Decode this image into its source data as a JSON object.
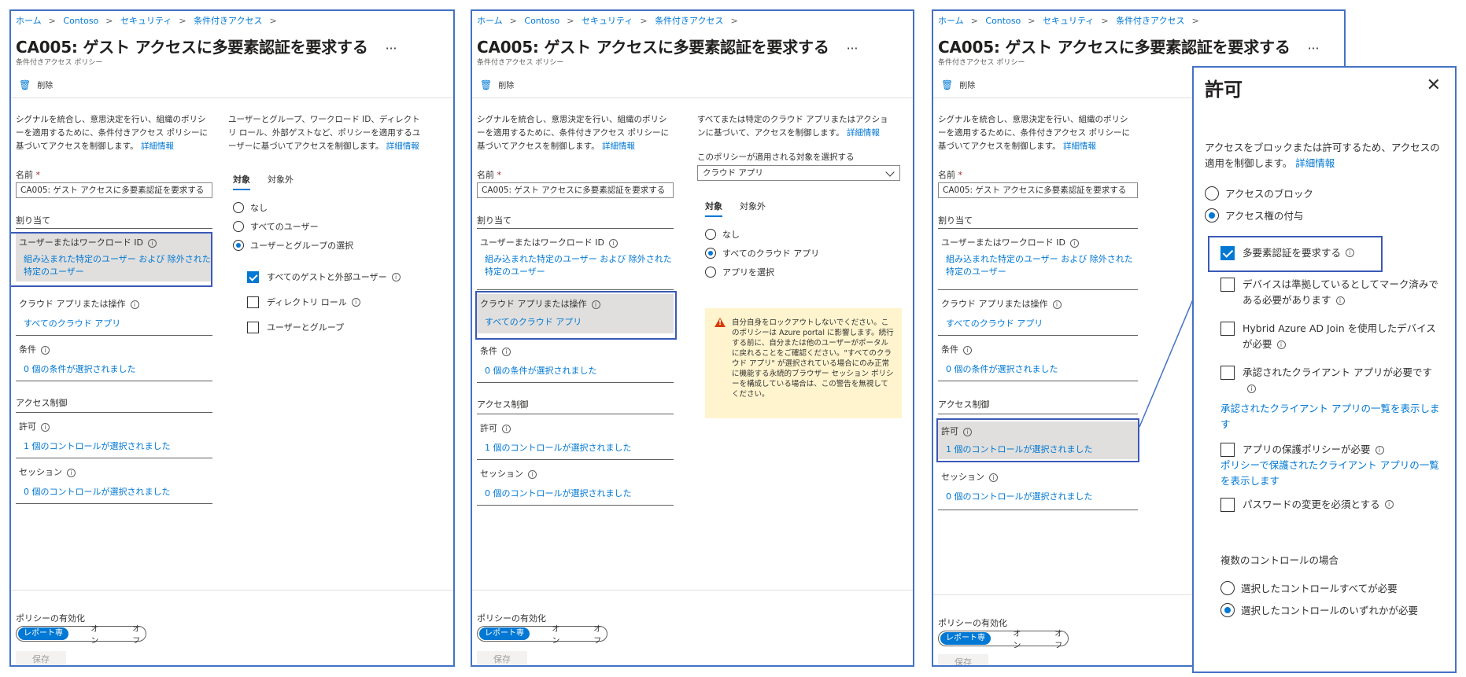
{
  "breadcrumb": [
    "ホーム",
    "Contoso",
    "セキュリティ",
    "条件付きアクセス"
  ],
  "page": {
    "title": "CA005: ゲスト アクセスに多要素認証を要求する",
    "ellipsis": "···",
    "subtitle": "条件付きアクセス ポリシー",
    "delete_label": "削除"
  },
  "left": {
    "description": "シグナルを統合し、意思決定を行い、組織のポリシーを適用するために、条件付きアクセス ポリシーに基づいてアクセスを制御します。",
    "learn_more": "詳細情報",
    "name_label": "名前",
    "name_required": "*",
    "name_value": "CA005: ゲスト アクセスに多要素認証を要求する",
    "assignments_heading": "割り当て",
    "users_label": "ユーザーまたはワークロード ID",
    "users_value": "組み込まれた特定のユーザー および 除外された特定のユーザー",
    "cloud_apps_label": "クラウド アプリまたは操作",
    "cloud_apps_value": "すべてのクラウド アプリ",
    "conditions_label": "条件",
    "conditions_value": "0 個の条件が選択されました",
    "access_controls_heading": "アクセス制御",
    "grant_label": "許可",
    "grant_value": "1 個のコントロールが選択されました",
    "session_label": "セッション",
    "session_value": "0 個のコントロールが選択されました",
    "enable_policy_label": "ポリシーの有効化",
    "toggle_options": [
      "レポート専用",
      "オン",
      "オフ"
    ],
    "save_label": "保存"
  },
  "users_pane": {
    "description": "ユーザーとグループ、ワークロード ID、ディレクトリ ロール、外部ゲストなど、ポリシーを適用するユーザーに基づいてアクセスを制御します。",
    "learn_more": "詳細情報",
    "tabs": [
      "対象",
      "対象外"
    ],
    "radios": [
      "なし",
      "すべてのユーザー",
      "ユーザーとグループの選択"
    ],
    "selected_radio": 2,
    "checkboxes": [
      "すべてのゲストと外部ユーザー",
      "ディレクトリ ロール",
      "ユーザーとグループ"
    ],
    "checked": [
      true,
      false,
      false
    ]
  },
  "apps_pane": {
    "description": "すべてまたは特定のクラウド アプリまたはアクションに基づいて、アクセスを制御します。",
    "learn_more": "詳細情報",
    "select_label": "このポリシーが適用される対象を選択する",
    "select_value": "クラウド アプリ",
    "tabs": [
      "対象",
      "対象外"
    ],
    "radios": [
      "なし",
      "すべてのクラウド アプリ",
      "アプリを選択"
    ],
    "selected_radio": 1,
    "warning": "自分自身をロックアウトしないでください。このポリシーは Azure portal に影響します。続行する前に、自分または他のユーザーがポータルに戻れることをご確認ください。\"すべてのクラウド アプリ\" が選択されている場合にのみ正常に機能する永続的ブラウザー セッション ポリシーを構成している場合は、この警告を無視してください。"
  },
  "grant_pane": {
    "title": "許可",
    "close": "✕",
    "description": "アクセスをブロックまたは許可するため、アクセスの適用を制御します。",
    "learn_more": "詳細情報",
    "block_label": "アクセスのブロック",
    "grant_label": "アクセス権の付与",
    "selected": "grant",
    "controls": [
      {
        "label": "多要素認証を要求する",
        "checked": true
      },
      {
        "label": "デバイスは準拠しているとしてマーク済みである必要があります",
        "checked": false
      },
      {
        "label": "Hybrid Azure AD Join を使用したデバイスが必要",
        "checked": false
      },
      {
        "label": "承認されたクライアント アプリが必要です",
        "checked": false,
        "link": "承認されたクライアント アプリの一覧を表示します"
      },
      {
        "label": "アプリの保護ポリシーが必要",
        "checked": false,
        "link": "ポリシーで保護されたクライアント アプリの一覧を表示します"
      },
      {
        "label": "パスワードの変更を必須とする",
        "checked": false
      }
    ],
    "multiple_heading": "複数のコントロールの場合",
    "require_all": "選択したコントロールすべてが必要",
    "require_one": "選択したコントロールのいずれかが必要",
    "multiple_selected": "one"
  }
}
